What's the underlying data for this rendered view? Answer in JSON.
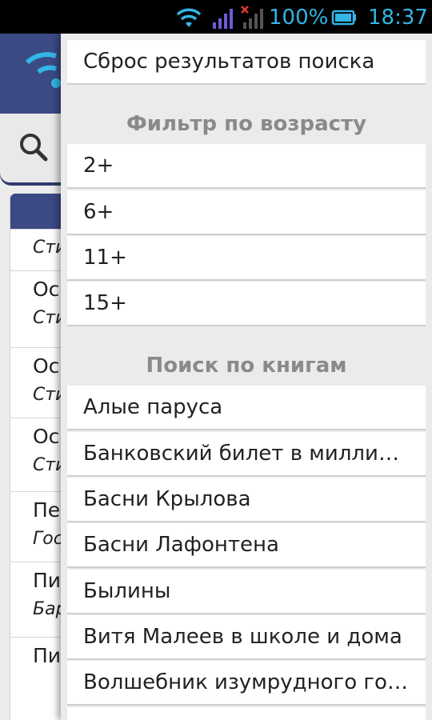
{
  "status_bar": {
    "battery_percent": "100%",
    "time": "18:37",
    "accent_color": "#33b5e5"
  },
  "background_app": {
    "header_color": "#3b4a84",
    "rows": [
      {
        "line1": "",
        "line2": "Сти"
      },
      {
        "line1": "Ос",
        "line2": "Сти"
      },
      {
        "line1": "Ос",
        "line2": "Сти"
      },
      {
        "line1": "Ос",
        "line2": "Сти"
      },
      {
        "line1": "Пе",
        "line2": "Гос"
      },
      {
        "line1": "Пи",
        "line2": "Бар"
      },
      {
        "line1": "Пи",
        "line2": ""
      }
    ]
  },
  "drawer": {
    "reset_label": "Сброс результатов поиска",
    "age_filter_title": "Фильтр по возрасту",
    "age_filters": [
      "2+",
      "6+",
      "11+",
      "15+"
    ],
    "books_title": "Поиск по книгам",
    "books": [
      "Алые паруса",
      "Банковский билет в милли…",
      "Басни Крылова",
      "Басни Лафонтена",
      "Былины",
      "Витя Малеев в школе и дома",
      "Волшебник изумрудного го…"
    ]
  }
}
